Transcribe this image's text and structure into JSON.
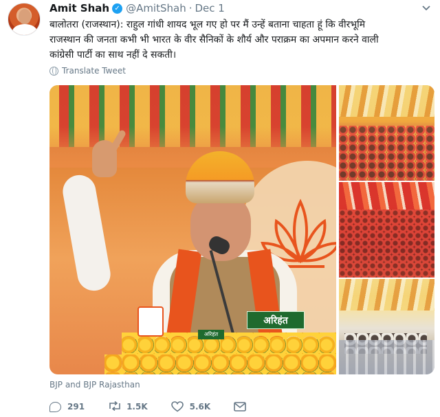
{
  "tweet": {
    "author_name": "Amit Shah",
    "handle": "@AmitShah",
    "separator": "·",
    "date": "Dec 1",
    "text_line1": "बालोतरा (राजस्थान): राहुल गांधी शायद भूल गए हो पर मैं उन्हें बताना चाहता हूं कि वीरभूमि",
    "text_line2": "राजस्थान की जनता कभी भी भारत के वीर सैनिकों के शौर्य और पराक्रम का अपमान करने वाली",
    "text_line3": "कांग्रेसी पार्टी का साथ नहीं दे सकती।",
    "translate_label": "Translate Tweet",
    "media_watermark": "अरिहंत",
    "media_watermark_small": "अरिहंत",
    "photo_credit": "BJP and BJP Rajasthan",
    "verified_glyph": "✓",
    "icons": {
      "reply": "reply-icon",
      "retweet": "retweet-icon",
      "like": "heart-icon",
      "message": "envelope-icon",
      "more": "chevron-down-icon",
      "translate": "globe-icon"
    },
    "stats": {
      "replies": "291",
      "retweets": "1.5K",
      "likes": "5.6K"
    },
    "colors": {
      "verified": "#1da1f2",
      "secondary_text": "#657786"
    }
  }
}
